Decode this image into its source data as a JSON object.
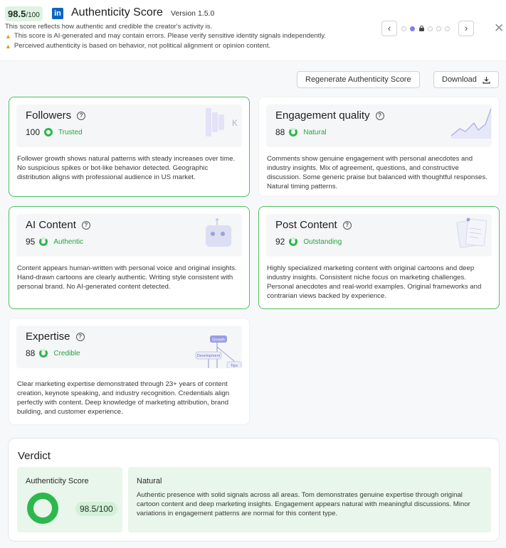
{
  "header": {
    "score_value": "98.5",
    "score_total": "/100",
    "logo_text": "in",
    "title": "Authenticity Score",
    "version": "Version 1.5.0",
    "description": "This score reflects how authentic and credible the creator's activity is.",
    "warnings": [
      "This score is AI-generated and may contain errors. Please verify sensitive identity signals independently.",
      "Perceived authenticity is based on behavior, not political alignment or opinion content."
    ],
    "prev_icon": "chevron-left-icon",
    "next_icon": "chevron-right-icon",
    "close_icon": "close-icon"
  },
  "actions": {
    "regenerate_label": "Regenerate Authenticity Score",
    "download_label": "Download"
  },
  "cards": [
    {
      "title": "Followers",
      "score": "100",
      "label": "Trusted",
      "text": "Follower growth shows natural patterns with steady increases over time. No suspicious spikes or bot-like behavior detected. Geographic distribution aligns with professional audience in US market.",
      "illustration_text": "K"
    },
    {
      "title": "Engagement quality",
      "score": "88",
      "label": "Natural",
      "text": "Comments show genuine engagement with personal anecdotes and industry insights. Mix of agreement, questions, and constructive discussion. Some generic praise but balanced with thoughtful responses. Natural timing patterns."
    },
    {
      "title": "AI Content",
      "score": "95",
      "label": "Authentic",
      "text": "Content appears human-written with personal voice and original insights. Hand-drawn cartoons are clearly authentic. Writing style consistent with personal brand. No AI-generated content detected."
    },
    {
      "title": "Post Content",
      "score": "92",
      "label": "Outstanding",
      "text": "Highly specialized marketing content with original cartoons and deep industry insights. Consistent niche focus on marketing challenges. Personal anecdotes and real-world examples. Original frameworks and contrarian views backed by experience."
    },
    {
      "title": "Expertise",
      "score": "88",
      "label": "Credible",
      "text": "Clear marketing expertise demonstrated through 23+ years of content creation, keynote speaking, and industry recognition. Credentials align perfectly with content. Deep knowledge of marketing attribution, brand building, and customer experience.",
      "illustration_labels": [
        "Growth",
        "Development",
        "Tips"
      ]
    }
  ],
  "verdict": {
    "title": "Verdict",
    "score_label": "Authenticity Score",
    "score_value": "98.5/100",
    "score_fraction": 0.985,
    "summary_label": "Natural",
    "summary_text": "Authentic presence with solid signals across all areas. Tom demonstrates genuine expertise through original cartoon content and deep marketing insights. Engagement appears natural with meaningful discussions. Minor variations in engagement patterns are normal for this content type."
  },
  "colors": {
    "accent_green": "#2db84d",
    "card_border_green": "#4cc15f",
    "linkedin_blue": "#0a66c2",
    "active_dot": "#7c80e8",
    "warning_yellow": "#e0a117"
  }
}
